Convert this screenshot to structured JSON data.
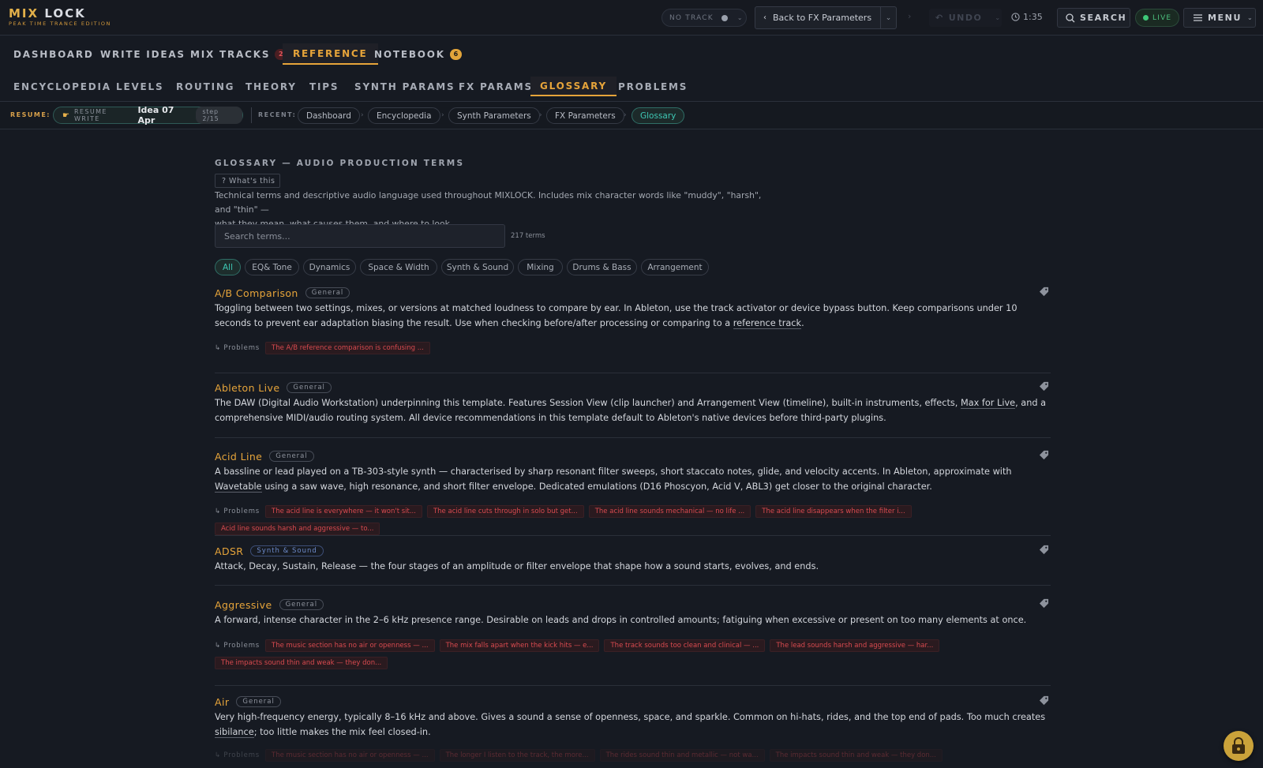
{
  "app": {
    "logo_main_a": "MIX",
    "logo_main_b": "LOCK",
    "logo_sub": "PEAK TIME TRANCE EDITION"
  },
  "topbar": {
    "no_track": "NO TRACK",
    "back_label": "Back to FX Parameters",
    "undo_label": "UNDO",
    "timer": "1:35",
    "search_label": "SEARCH",
    "live_label": "LIVE",
    "menu_label": "MENU"
  },
  "main_tabs": [
    {
      "label": "DASHBOARD"
    },
    {
      "label": "WRITE IDEAS"
    },
    {
      "label": "MIX TRACKS",
      "badge": "2"
    },
    {
      "label": "REFERENCE"
    },
    {
      "label": "NOTEBOOK",
      "badge": "6"
    }
  ],
  "sub_tabs": [
    {
      "label": "ENCYCLOPEDIA"
    },
    {
      "label": "LEVELS"
    },
    {
      "label": "ROUTING"
    },
    {
      "label": "THEORY"
    },
    {
      "label": "TIPS"
    },
    {
      "label": "SYNTH PARAMS"
    },
    {
      "label": "FX PARAMS"
    },
    {
      "label": "GLOSSARY"
    },
    {
      "label": "PROBLEMS"
    }
  ],
  "resume": {
    "label": "RESUME:",
    "resume_write": "RESUME WRITE",
    "idea": "Idea 07 Apr",
    "step": "step 2/15",
    "recent_label": "RECENT:",
    "crumbs": [
      "Dashboard",
      "Encyclopedia",
      "Synth Parameters",
      "FX Parameters",
      "Glossary"
    ]
  },
  "glossary": {
    "title": "GLOSSARY — AUDIO PRODUCTION TERMS",
    "whats_this": "? What's this",
    "intro_1": "Technical terms and descriptive audio language used throughout MIXLOCK. Includes mix character words like \"muddy\", \"harsh\", and \"thin\" —",
    "intro_2": "what they mean, what causes them, and where to look.",
    "search_placeholder": "Search terms...",
    "term_count": "217 terms",
    "filters": [
      "All",
      "EQ& Tone",
      "Dynamics",
      "Space & Width",
      "Synth & Sound",
      "Mixing",
      "Drums & Bass",
      "Arrangement"
    ],
    "problems_label": "↳ Problems",
    "entries": [
      {
        "term": "A/B Comparison",
        "category": "General",
        "desc_a": "Toggling between two settings, mixes, or versions at matched loudness to compare by ear. In Ableton, use the track activator or device bypass button. Keep comparisons under 10 seconds to prevent ear adaptation biasing the result. Use when checking before/after processing or comparing to a ",
        "desc_link": "reference track",
        "desc_b": ".",
        "problems": [
          "The A/B reference comparison is confusing ..."
        ]
      },
      {
        "term": "Ableton Live",
        "category": "General",
        "desc_a": "The DAW (Digital Audio Workstation) underpinning this template. Features Session View (clip launcher) and Arrangement View (timeline), built-in instruments, effects, ",
        "desc_link": "Max for Live",
        "desc_b": ", and a comprehensive MIDI/audio routing system. All device recommendations in this template default to Ableton's native devices before third-party plugins.",
        "problems": []
      },
      {
        "term": "Acid Line",
        "category": "General",
        "desc_a": "A bassline or lead played on a TB-303-style synth — characterised by sharp resonant filter sweeps, short staccato notes, glide, and velocity accents. In Ableton, approximate with ",
        "desc_link": "Wavetable",
        "desc_b": " using a saw wave, high resonance, and short filter envelope. Dedicated emulations (D16 Phoscyon, Acid V, ABL3) get closer to the original character.",
        "problems": [
          "The acid line is everywhere — it won't sit...",
          "The acid line cuts through in solo but get...",
          "The acid line sounds mechanical — no life ...",
          "The acid line disappears when the filter i...",
          "Acid line sounds harsh and aggressive — to..."
        ]
      },
      {
        "term": "ADSR",
        "category": "Synth & Sound",
        "desc_a": "Attack, Decay, Sustain, Release — the four stages of an amplitude or filter envelope that shape how a sound starts, evolves, and ends.",
        "desc_link": "",
        "desc_b": "",
        "problems": []
      },
      {
        "term": "Aggressive",
        "category": "General",
        "desc_a": "A forward, intense character in the 2–6 kHz presence range. Desirable on leads and drops in controlled amounts; fatiguing when excessive or present on too many elements at once.",
        "desc_link": "",
        "desc_b": "",
        "problems": [
          "The music section has no air or openness — ...",
          "The mix falls apart when the kick hits — e...",
          "The track sounds too clean and clinical — ...",
          "The lead sounds harsh and aggressive — har...",
          "The impacts sound thin and weak — they don..."
        ]
      },
      {
        "term": "Air",
        "category": "General",
        "desc_a": "Very high-frequency energy, typically 8–16 kHz and above. Gives a sound a sense of openness, space, and sparkle. Common on hi-hats, rides, and the top end of pads. Too much creates ",
        "desc_link": "sibilance",
        "desc_b": "; too little makes the mix feel closed-in.",
        "problems": [
          "The music section has no air or openness — ...",
          "The longer I listen to the track, the more...",
          "The rides sound thin and metallic — not wa...",
          "The impacts sound thin and weak — they don..."
        ]
      }
    ]
  }
}
